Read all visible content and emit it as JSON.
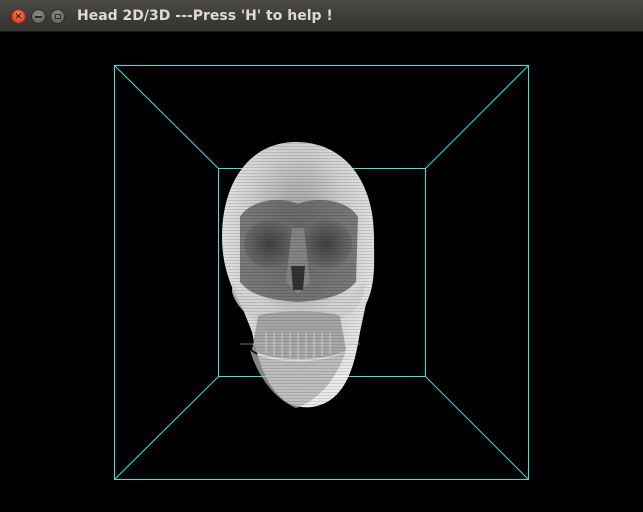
{
  "window": {
    "title": "Head 2D/3D ---Press 'H' to help !",
    "buttons": {
      "close": "×"
    }
  },
  "viewport": {
    "background": "#000000",
    "box_color": "#2ee6e6",
    "render": "skull-volume-render"
  }
}
